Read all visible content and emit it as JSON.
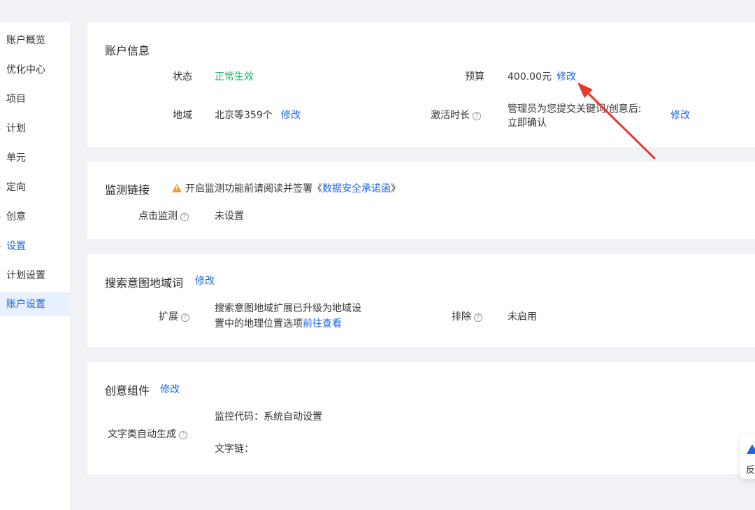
{
  "sidebar": {
    "items": [
      {
        "label": "账户概览",
        "chevron": false
      },
      {
        "label": "优化中心",
        "chevron": false
      },
      {
        "label": "项目",
        "chevron": false
      },
      {
        "label": "计划",
        "chevron": true
      },
      {
        "label": "单元",
        "chevron": false
      },
      {
        "label": "定向",
        "chevron": true
      },
      {
        "label": "创意",
        "chevron": true
      },
      {
        "label": "设置",
        "chevron": true
      },
      {
        "label": "计划设置",
        "chevron": false
      },
      {
        "label": "账户设置",
        "chevron": false
      }
    ]
  },
  "account_info": {
    "title": "账户信息",
    "status_label": "状态",
    "status_value": "正常生效",
    "budget_label": "预算",
    "budget_value": "400.00元",
    "budget_edit": "修改",
    "region_label": "地域",
    "region_value": "北京等359个",
    "region_edit": "修改",
    "activation_label": "激活时长",
    "activation_value_line1": "管理员为您提交关键词/创意后:",
    "activation_value_line2": "立即确认",
    "activation_edit": "修改"
  },
  "monitoring": {
    "title": "监测链接",
    "notice_prefix": "开启监测功能前请阅读并签署《",
    "notice_link": "数据安全承诺函",
    "notice_suffix": "》",
    "click_label": "点击监测",
    "click_value": "未设置"
  },
  "search_intent": {
    "title": "搜索意图地域词",
    "edit": "修改",
    "expand_label": "扩展",
    "expand_line1": "搜索意图地域扩展已升级为地域设",
    "expand_line2": "置中的地理位置选项",
    "expand_link": "前往查看",
    "exclude_label": "排除",
    "exclude_value": "未启用"
  },
  "creative": {
    "title": "创意组件",
    "edit": "修改",
    "auto_label": "文字类自动生成",
    "monitor_code": "监控代码：系统自动设置",
    "text_chain": "文字链："
  },
  "help_glyph": "?",
  "feedback": {
    "label": "反"
  },
  "colors": {
    "accent": "#1a66e0",
    "status_ok": "#21b35e",
    "arrow": "#e8372c"
  }
}
